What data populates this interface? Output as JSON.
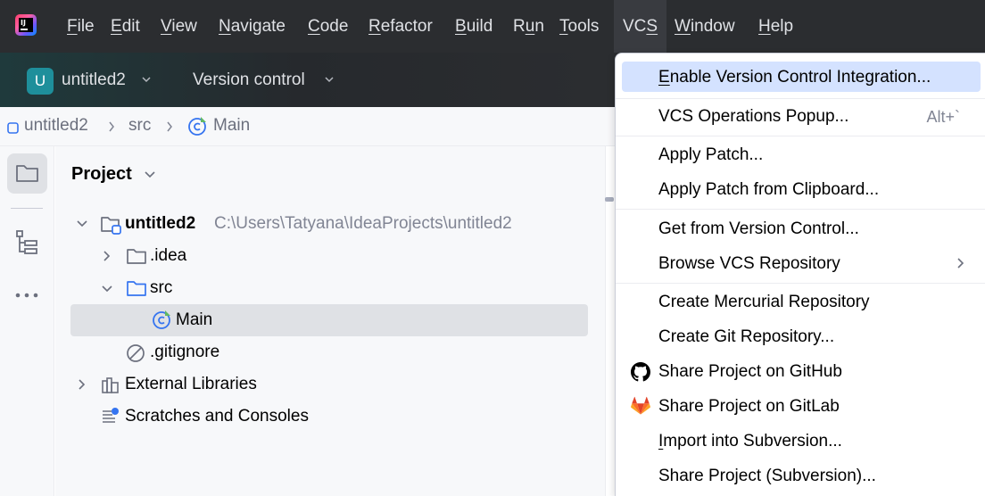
{
  "menubar": {
    "items": [
      {
        "pre": "",
        "mn": "F",
        "post": "ile"
      },
      {
        "pre": "",
        "mn": "E",
        "post": "dit"
      },
      {
        "pre": "",
        "mn": "V",
        "post": "iew"
      },
      {
        "pre": "",
        "mn": "N",
        "post": "avigate"
      },
      {
        "pre": "",
        "mn": "C",
        "post": "ode"
      },
      {
        "pre": "",
        "mn": "R",
        "post": "efactor"
      },
      {
        "pre": "",
        "mn": "B",
        "post": "uild"
      },
      {
        "pre": "R",
        "mn": "u",
        "post": "n"
      },
      {
        "pre": "",
        "mn": "T",
        "post": "ools"
      },
      {
        "pre": "VC",
        "mn": "S",
        "post": ""
      },
      {
        "pre": "",
        "mn": "W",
        "post": "indow"
      },
      {
        "pre": "",
        "mn": "H",
        "post": "elp"
      }
    ]
  },
  "toolbar": {
    "project_badge": "U",
    "project_name": "untitled2",
    "vcs_widget": "Version control"
  },
  "breadcrumb": {
    "project": "untitled2",
    "folder": "src",
    "file": "Main"
  },
  "project_panel": {
    "title": "Project",
    "tree": {
      "root_name": "untitled2",
      "root_path": "C:\\Users\\Tatyana\\IdeaProjects\\untitled2",
      "idea": ".idea",
      "src": "src",
      "main": "Main",
      "gitignore": ".gitignore",
      "external_libraries": "External Libraries",
      "scratches": "Scratches and Consoles"
    }
  },
  "vcs_menu": {
    "enable_integration": {
      "pre": "",
      "mn": "E",
      "post": "nable Version Control Integration..."
    },
    "operations_popup": "VCS Operations Popup...",
    "operations_popup_shortcut": "Alt+`",
    "apply_patch": "Apply Patch...",
    "apply_patch_clipboard": "Apply Patch from Clipboard...",
    "get_from_vcs": "Get from Version Control...",
    "browse_repo": "Browse VCS Repository",
    "create_mercurial": "Create Mercurial Repository",
    "create_git": "Create Git Repository...",
    "share_github": "Share Project on GitHub",
    "share_gitlab": "Share Project on GitLab",
    "import_svn": {
      "pre": "",
      "mn": "I",
      "post": "mport into Subversion..."
    },
    "share_svn": "Share Project (Subversion)..."
  },
  "colors": {
    "menubar_bg": "#2b2d30",
    "highlight": "#d4e2ff",
    "selection": "#dfe1e5",
    "project_badge": "#1e8f9b"
  }
}
